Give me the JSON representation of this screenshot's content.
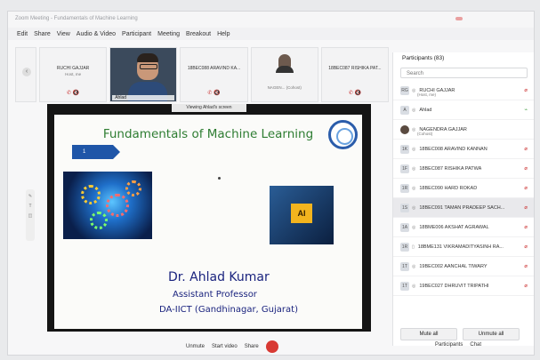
{
  "window": {
    "title": "Zoom Meeting - Fundamentals of Machine Learning"
  },
  "menu": [
    "Edit",
    "Share",
    "View",
    "Audio & Video",
    "Participant",
    "Meeting",
    "Breakout",
    "Help"
  ],
  "gallery": [
    {
      "name": "RUCHI GAJJAR",
      "sub": "Host, me",
      "icons": "✆ 🔇"
    },
    {
      "name": "Ahlad",
      "sub": "",
      "icons": ""
    },
    {
      "name": "18BEC088 ARAVIND KA...",
      "sub": "",
      "icons": "✆ 🔇"
    },
    {
      "name": "NAGEN...",
      "sub": "(Cohost)",
      "icons": ""
    },
    {
      "name": "18BEC087 RISHIKA PAT...",
      "sub": "",
      "icons": "✆ 🔇"
    }
  ],
  "screen_share": {
    "banner": "Viewing Ahlad's screen",
    "slide_title": "Fundamentals of Machine Learning",
    "slide_number": "1",
    "presenter": "Dr. Ahlad Kumar",
    "role": "Assistant Professor",
    "institution": "DA-IICT (Gandhinagar, Gujarat)"
  },
  "participants": {
    "header": "Participants (83)",
    "search_placeholder": "Search",
    "rows": [
      {
        "avatar": "RG",
        "name": "RUCHI GAJJAR",
        "sub": "(Host, me)"
      },
      {
        "avatar": "A",
        "name": "Ahlad",
        "sub": ""
      },
      {
        "avatar": "",
        "name": "NAGENDRA GAJJAR",
        "sub": "(Cohost)"
      },
      {
        "avatar": "1K",
        "name": "18BEC008 ARAVIND KANNAN",
        "sub": ""
      },
      {
        "avatar": "1F",
        "name": "18BEC087 RISHIKA PATWA",
        "sub": ""
      },
      {
        "avatar": "1R",
        "name": "18BEC090 HARD ROKAD",
        "sub": ""
      },
      {
        "avatar": "1S",
        "name": "18BEC091 TAMAN PRADEEP SACH...",
        "sub": ""
      },
      {
        "avatar": "1A",
        "name": "18BME006 AKSHAT AGRAWAL",
        "sub": ""
      },
      {
        "avatar": "1R",
        "name": "18BME131 VIKRAMADITYASINH RA...",
        "sub": ""
      },
      {
        "avatar": "1T",
        "name": "19BEC002 AANCHAL TIWARY",
        "sub": ""
      },
      {
        "avatar": "1T",
        "name": "19BEC027 DHRUVIT TRIPATHI",
        "sub": ""
      }
    ],
    "mute_all": "Mute all",
    "unmute_all": "Unmute all"
  },
  "toolbar": {
    "unmute": "Unmute",
    "start_video": "Start video",
    "share": "Share",
    "participants": "Participants",
    "chat": "Chat"
  },
  "colors": {
    "slide_title": "#2e7d32",
    "presenter": "#1a237e",
    "end_button": "#d83a34"
  }
}
